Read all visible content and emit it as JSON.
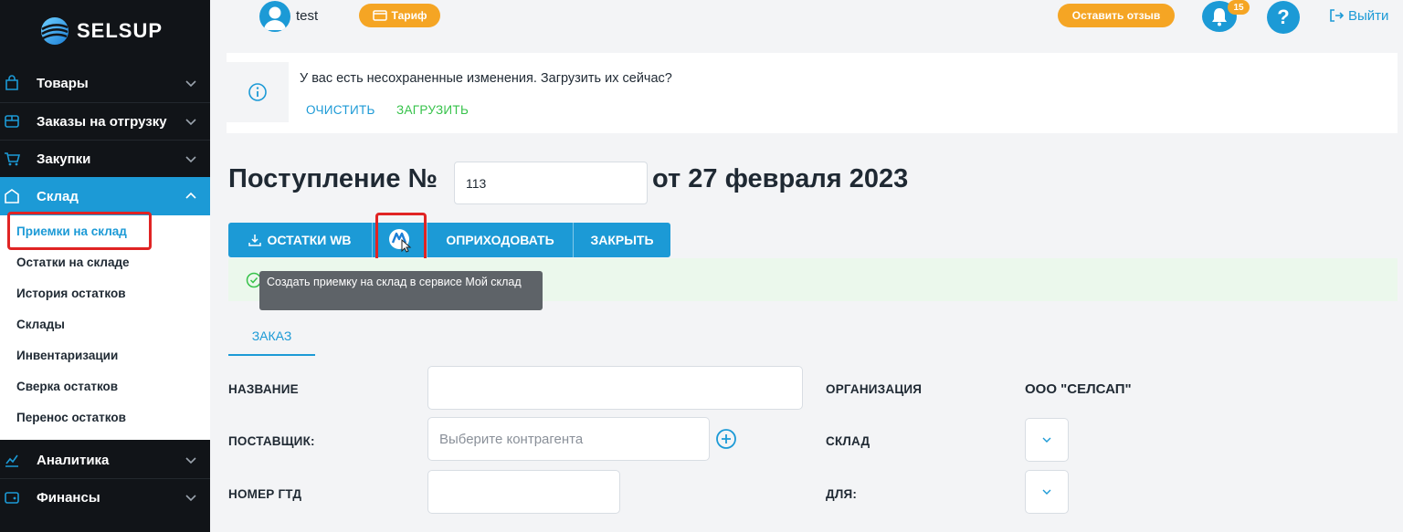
{
  "brand": {
    "name": "SELSUP"
  },
  "sidebar": {
    "items": [
      {
        "label": "Товары",
        "icon": "bag-icon"
      },
      {
        "label": "Заказы на отгрузку",
        "icon": "box-icon"
      },
      {
        "label": "Закупки",
        "icon": "cart-icon"
      },
      {
        "label": "Склад",
        "icon": "warehouse-icon",
        "active": true
      },
      {
        "label": "Аналитика",
        "icon": "chart-icon"
      },
      {
        "label": "Финансы",
        "icon": "wallet-icon"
      }
    ],
    "submenu": [
      {
        "label": "Приемки на склад",
        "current": true
      },
      {
        "label": "Остатки на складе"
      },
      {
        "label": "История остатков"
      },
      {
        "label": "Склады"
      },
      {
        "label": "Инвентаризации"
      },
      {
        "label": "Сверка остатков"
      },
      {
        "label": "Перенос остатков"
      }
    ]
  },
  "header": {
    "username": "test",
    "tariff_label": "Тариф",
    "feedback_label": "Оставить отзыв",
    "notifications_count": "15",
    "help_label": "?",
    "logout_label": "Выйти"
  },
  "notice": {
    "text": "У вас есть несохраненные изменения. Загрузить их сейчас?",
    "clear_label": "ОЧИСТИТЬ",
    "load_label": "ЗАГРУЗИТЬ"
  },
  "document": {
    "title_prefix": "Поступление №",
    "number": "113",
    "title_suffix": "от 27 февраля 2023"
  },
  "toolbar": {
    "wb_stock_label": "ОСТАТКИ WB",
    "post_label": "ОПРИХОДОВАТЬ",
    "close_label": "ЗАКРЫТЬ"
  },
  "tooltip": {
    "text": "Создать приемку на склад в сервисе Мой склад"
  },
  "tabs": [
    {
      "label": "ЗАКАЗ"
    }
  ],
  "form": {
    "name_label": "НАЗВАНИЕ",
    "name_value": "",
    "supplier_label": "ПОСТАВЩИК:",
    "supplier_placeholder": "Выберите контрагента",
    "gtd_label": "НОМЕР ГТД",
    "gtd_value": "",
    "org_label": "ОРГАНИЗАЦИЯ",
    "org_value": "ООО \"СЕЛСАП\"",
    "warehouse_label": "СКЛАД",
    "for_label": "ДЛЯ:"
  },
  "colors": {
    "accent": "#1c9ad6",
    "orange": "#f5a524",
    "green": "#36c24a",
    "highlight": "#e02424"
  }
}
